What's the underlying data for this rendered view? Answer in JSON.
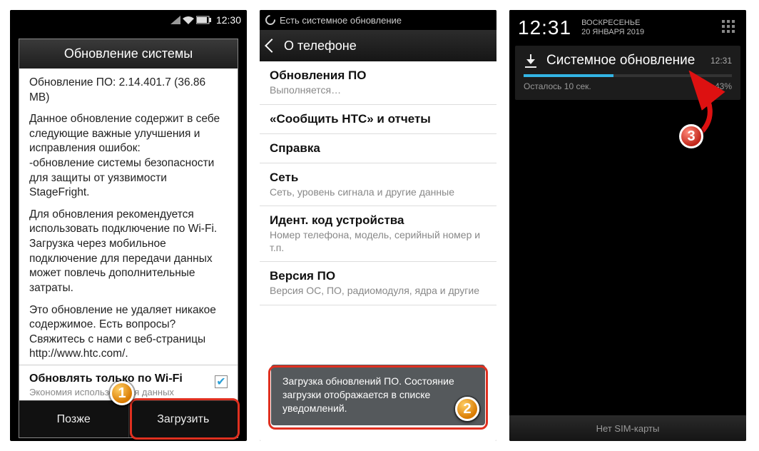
{
  "phone1": {
    "status_time": "12:30",
    "dialog_title": "Обновление системы",
    "version_line": "Обновление ПО: 2.14.401.7 (36.86 MB)",
    "para1": "Данное обновление содержит в себе следующие важные улучшения и исправления ошибок:",
    "para1b": " -обновление системы безопасности для защиты от уязвимости StageFright.",
    "para2": "Для обновления рекомендуется использовать подключение по Wi-Fi. Загрузка через мобильное подключение для передачи данных может повлечь дополнительные затраты.",
    "para3": "Это обновление не удаляет никакое содержимое. Есть вопросы? Свяжитесь с нами с веб-страницы http://www.htc.com/.",
    "wifi_label": "Обновлять только по Wi-Fi",
    "wifi_sub": "Экономия использования данных",
    "wifi_checked": "✔",
    "btn_later": "Позже",
    "btn_download": "Загрузить"
  },
  "phone2": {
    "topbar": "Есть системное обновление",
    "header": "О телефоне",
    "items": [
      {
        "title": "Обновления ПО",
        "sub": "Выполняется…"
      },
      {
        "title": "«Сообщить HTC» и отчеты",
        "sub": ""
      },
      {
        "title": "Справка",
        "sub": ""
      },
      {
        "title": "Сеть",
        "sub": "Сеть, уровень сигнала и другие данные"
      },
      {
        "title": "Идент. код устройства",
        "sub": "Номер телефона, модель, серийный номер и т.п."
      },
      {
        "title": "Версия ПО",
        "sub": "Версия ОС, ПО, радиомодуля, ядра и другие"
      }
    ],
    "toast": "Загрузка обновлений ПО. Состояние загрузки отображается в списке уведомлений."
  },
  "phone3": {
    "clock": "12:31",
    "day": "ВОСКРЕСЕНЬЕ",
    "date": "20 ЯНВАРЯ 2019",
    "notif_title": "Системное обновление",
    "notif_time": "12:31",
    "remaining": "Осталось 10 сек.",
    "percent": "43%",
    "progress_pct": 43,
    "bottom": "Нет SIM-карты"
  },
  "badges": {
    "b1": "1",
    "b2": "2",
    "b3": "3"
  }
}
